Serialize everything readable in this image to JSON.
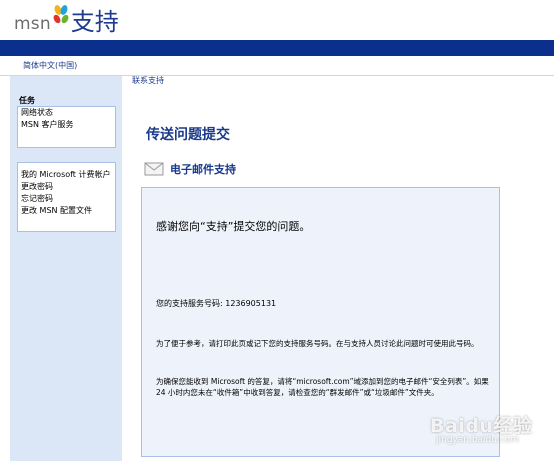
{
  "header": {
    "logo_text": "msn",
    "title": "支持"
  },
  "lang_selector": "简体中文(中国)",
  "breadcrumb": "联系支持",
  "sidebar": {
    "heading": "任务",
    "group1": [
      "网络状态",
      "MSN 客户服务"
    ],
    "group2": [
      "我的 Microsoft 计费帐户",
      "更改密码",
      "忘记密码",
      "更改 MSN 配置文件"
    ]
  },
  "main": {
    "page_title": "传送问题提交",
    "section_title": "电子邮件支持",
    "thanks": "感谢您向“支持”提交您的问题。",
    "service_number": "您的支持服务号码: 1236905131",
    "para1": "为了便于参考，请打印此页或记下您的支持服务号码。在与支持人员讨论此问题时可使用此号码。",
    "para2": "为确保您能收到 Microsoft 的答复，请将“microsoft.com”域添加到您的电子邮件“安全列表”。如果 24 小时内您未在“收件箱”中收到答复，请检查您的“群发邮件”或“垃圾邮件”文件夹。"
  },
  "watermark": {
    "text": "Baidu经验",
    "sub": "jingyan.baidu.com"
  },
  "icons": [
    "butterfly-logo-icon",
    "envelope-icon"
  ],
  "colors": {
    "nav_bar": "#0a2f8c",
    "link_blue": "#1a3a8c",
    "sidebar_bg": "#dbe6f7",
    "content_bg": "#eef3fb"
  }
}
